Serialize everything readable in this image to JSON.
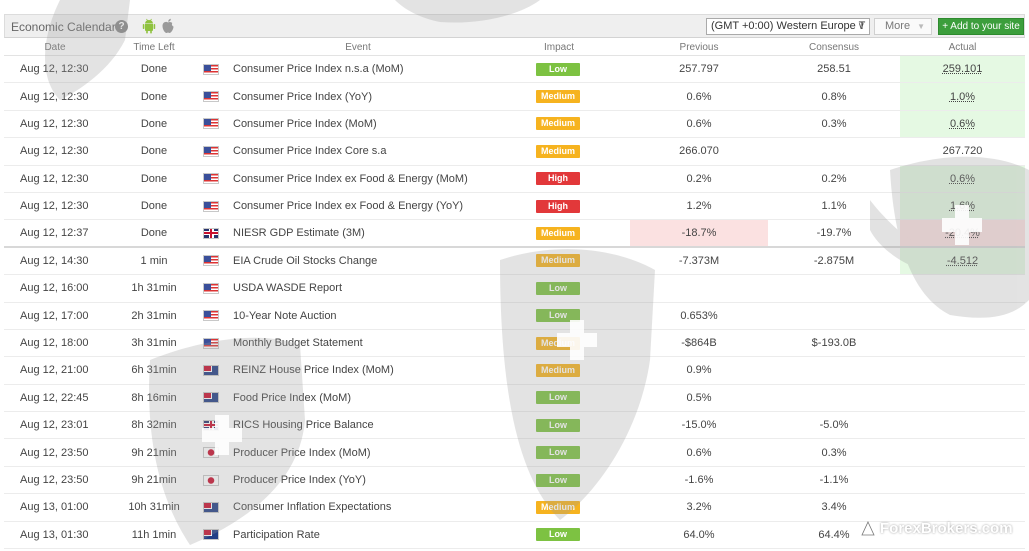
{
  "header": {
    "title": "Economic Calendar",
    "help": "?",
    "timezone": "(GMT +0:00) Western Europe T",
    "more_label": "More",
    "add_label": "+ Add to your site"
  },
  "columns": {
    "date": "Date",
    "time_left": "Time Left",
    "event": "Event",
    "impact": "Impact",
    "previous": "Previous",
    "consensus": "Consensus",
    "actual": "Actual"
  },
  "colors": {
    "low": "#7dc242",
    "medium": "#f6b31f",
    "high": "#e2383a",
    "add_button": "#3c9e3c",
    "actual_better": "#e5f9e3",
    "actual_worse": "#fbe1e1"
  },
  "rows": [
    {
      "date": "Aug 12, 12:30",
      "time_left": "Done",
      "flag": "us-flag-icon",
      "event": "Consumer Price Index n.s.a (MoM)",
      "impact": "Low",
      "previous": "257.797",
      "consensus": "258.51",
      "actual": "259.101"
    },
    {
      "date": "Aug 12, 12:30",
      "time_left": "Done",
      "flag": "us-flag-icon",
      "event": "Consumer Price Index (YoY)",
      "impact": "Medium",
      "previous": "0.6%",
      "consensus": "0.8%",
      "actual": "1.0%"
    },
    {
      "date": "Aug 12, 12:30",
      "time_left": "Done",
      "flag": "us-flag-icon",
      "event": "Consumer Price Index (MoM)",
      "impact": "Medium",
      "previous": "0.6%",
      "consensus": "0.3%",
      "actual": "0.6%"
    },
    {
      "date": "Aug 12, 12:30",
      "time_left": "Done",
      "flag": "us-flag-icon",
      "event": "Consumer Price Index Core s.a",
      "impact": "Medium",
      "previous": "266.070",
      "consensus": "",
      "actual": "267.720"
    },
    {
      "date": "Aug 12, 12:30",
      "time_left": "Done",
      "flag": "us-flag-icon",
      "event": "Consumer Price Index ex Food & Energy (MoM)",
      "impact": "High",
      "previous": "0.2%",
      "consensus": "0.2%",
      "actual": "0.6%"
    },
    {
      "date": "Aug 12, 12:30",
      "time_left": "Done",
      "flag": "us-flag-icon",
      "event": "Consumer Price Index ex Food & Energy (YoY)",
      "impact": "High",
      "previous": "1.2%",
      "consensus": "1.1%",
      "actual": "1.6%"
    },
    {
      "date": "Aug 12, 12:37",
      "time_left": "Done",
      "flag": "gb-flag-icon",
      "event": "NIESR GDP Estimate (3M)",
      "impact": "Medium",
      "previous": "-18.7%",
      "consensus": "-19.7%",
      "actual": "-20.4%"
    },
    {
      "date": "Aug 12, 14:30",
      "time_left": "1 min",
      "flag": "us-flag-icon",
      "event": "EIA Crude Oil Stocks Change",
      "impact": "Medium",
      "previous": "-7.373M",
      "consensus": "-2.875M",
      "actual": "-4.512"
    },
    {
      "date": "Aug 12, 16:00",
      "time_left": "1h 31min",
      "flag": "us-flag-icon",
      "event": "USDA WASDE Report",
      "impact": "Low",
      "previous": "",
      "consensus": "",
      "actual": ""
    },
    {
      "date": "Aug 12, 17:00",
      "time_left": "2h 31min",
      "flag": "us-flag-icon",
      "event": "10-Year Note Auction",
      "impact": "Low",
      "previous": "0.653%",
      "consensus": "",
      "actual": ""
    },
    {
      "date": "Aug 12, 18:00",
      "time_left": "3h 31min",
      "flag": "us-flag-icon",
      "event": "Monthly Budget Statement",
      "impact": "Medium",
      "previous": "-$864B",
      "consensus": "$-193.0B",
      "actual": ""
    },
    {
      "date": "Aug 12, 21:00",
      "time_left": "6h 31min",
      "flag": "nz-flag-icon",
      "event": "REINZ House Price Index (MoM)",
      "impact": "Medium",
      "previous": "0.9%",
      "consensus": "",
      "actual": ""
    },
    {
      "date": "Aug 12, 22:45",
      "time_left": "8h 16min",
      "flag": "nz-flag-icon",
      "event": "Food Price Index (MoM)",
      "impact": "Low",
      "previous": "0.5%",
      "consensus": "",
      "actual": ""
    },
    {
      "date": "Aug 12, 23:01",
      "time_left": "8h 32min",
      "flag": "gb-flag-icon",
      "event": "RICS Housing Price Balance",
      "impact": "Low",
      "previous": "-15.0%",
      "consensus": "-5.0%",
      "actual": ""
    },
    {
      "date": "Aug 12, 23:50",
      "time_left": "9h 21min",
      "flag": "jp-flag-icon",
      "event": "Producer Price Index (MoM)",
      "impact": "Low",
      "previous": "0.6%",
      "consensus": "0.3%",
      "actual": ""
    },
    {
      "date": "Aug 12, 23:50",
      "time_left": "9h 21min",
      "flag": "jp-flag-icon",
      "event": "Producer Price Index (YoY)",
      "impact": "Low",
      "previous": "-1.6%",
      "consensus": "-1.1%",
      "actual": ""
    },
    {
      "date": "Aug 13, 01:00",
      "time_left": "10h 31min",
      "flag": "au-flag-icon",
      "event": "Consumer Inflation Expectations",
      "impact": "Medium",
      "previous": "3.2%",
      "consensus": "3.4%",
      "actual": ""
    },
    {
      "date": "Aug 13, 01:30",
      "time_left": "11h 1min",
      "flag": "au-flag-icon",
      "event": "Participation Rate",
      "impact": "Low",
      "previous": "64.0%",
      "consensus": "64.4%",
      "actual": ""
    }
  ],
  "watermark": "ForexBrokers.com"
}
